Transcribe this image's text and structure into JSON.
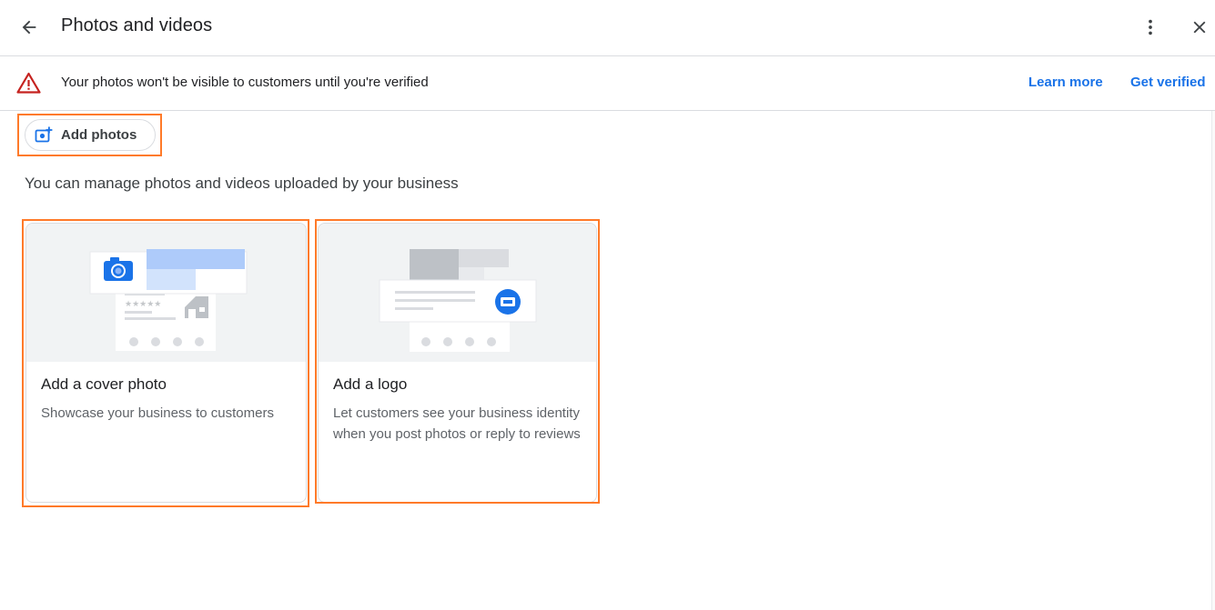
{
  "header": {
    "title": "Photos and videos",
    "back_icon": "arrow-left-icon",
    "more_icon": "more-vert-icon",
    "close_icon": "close-icon"
  },
  "banner": {
    "message": "Your photos won't be visible to customers until you're verified",
    "learn_more": "Learn more",
    "get_verified": "Get verified",
    "warning_icon": "warning-triangle-icon",
    "warning_color": "#c5221f"
  },
  "toolbar": {
    "add_photos_label": "Add photos",
    "add_photo_icon": "add-photo-icon"
  },
  "main": {
    "subtitle": "You can manage photos and videos uploaded by your business",
    "cards": [
      {
        "title": "Add a cover photo",
        "description": "Showcase your business to customers",
        "art_icon": "camera-icon"
      },
      {
        "title": "Add a logo",
        "description": "Let customers see your business identity when you post photos or reply to reviews",
        "art_icon": "logo-badge-icon"
      }
    ]
  },
  "colors": {
    "accent": "#1a73e8",
    "highlight": "#ff7a29",
    "warning": "#c5221f"
  }
}
